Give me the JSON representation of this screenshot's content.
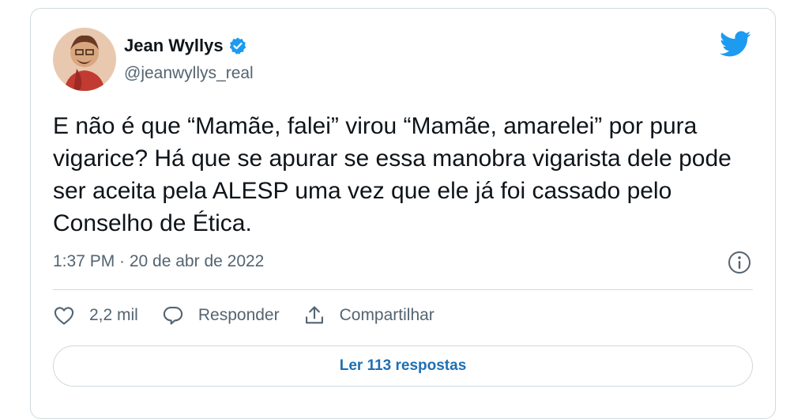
{
  "tweet": {
    "author_name": "Jean Wyllys",
    "handle": "@jeanwyllys_real",
    "text": "E não é que “Mamãe, falei” virou “Mamãe, amarelei” por pura vigarice? Há que se apurar se essa manobra vigarista dele pode ser aceita pela ALESP uma vez que ele já foi cassado pelo Conselho de Ética.",
    "timestamp": "1:37 PM · 20 de abr de 2022"
  },
  "actions": {
    "likes_count": "2,2 mil",
    "reply_label": "Responder",
    "share_label": "Compartilhar"
  },
  "replies_button_label": "Ler 113 respostas",
  "icons": {
    "avatar": "avatar-illustration",
    "verified": "verified-badge-icon",
    "brand": "twitter-bird-icon",
    "info": "info-icon",
    "like": "heart-icon",
    "reply": "speech-bubble-icon",
    "share": "share-icon"
  },
  "colors": {
    "brand_blue": "#1d9bf0",
    "link_blue": "#1d6fb5",
    "secondary_text": "#536471",
    "border": "#cfd9de"
  }
}
